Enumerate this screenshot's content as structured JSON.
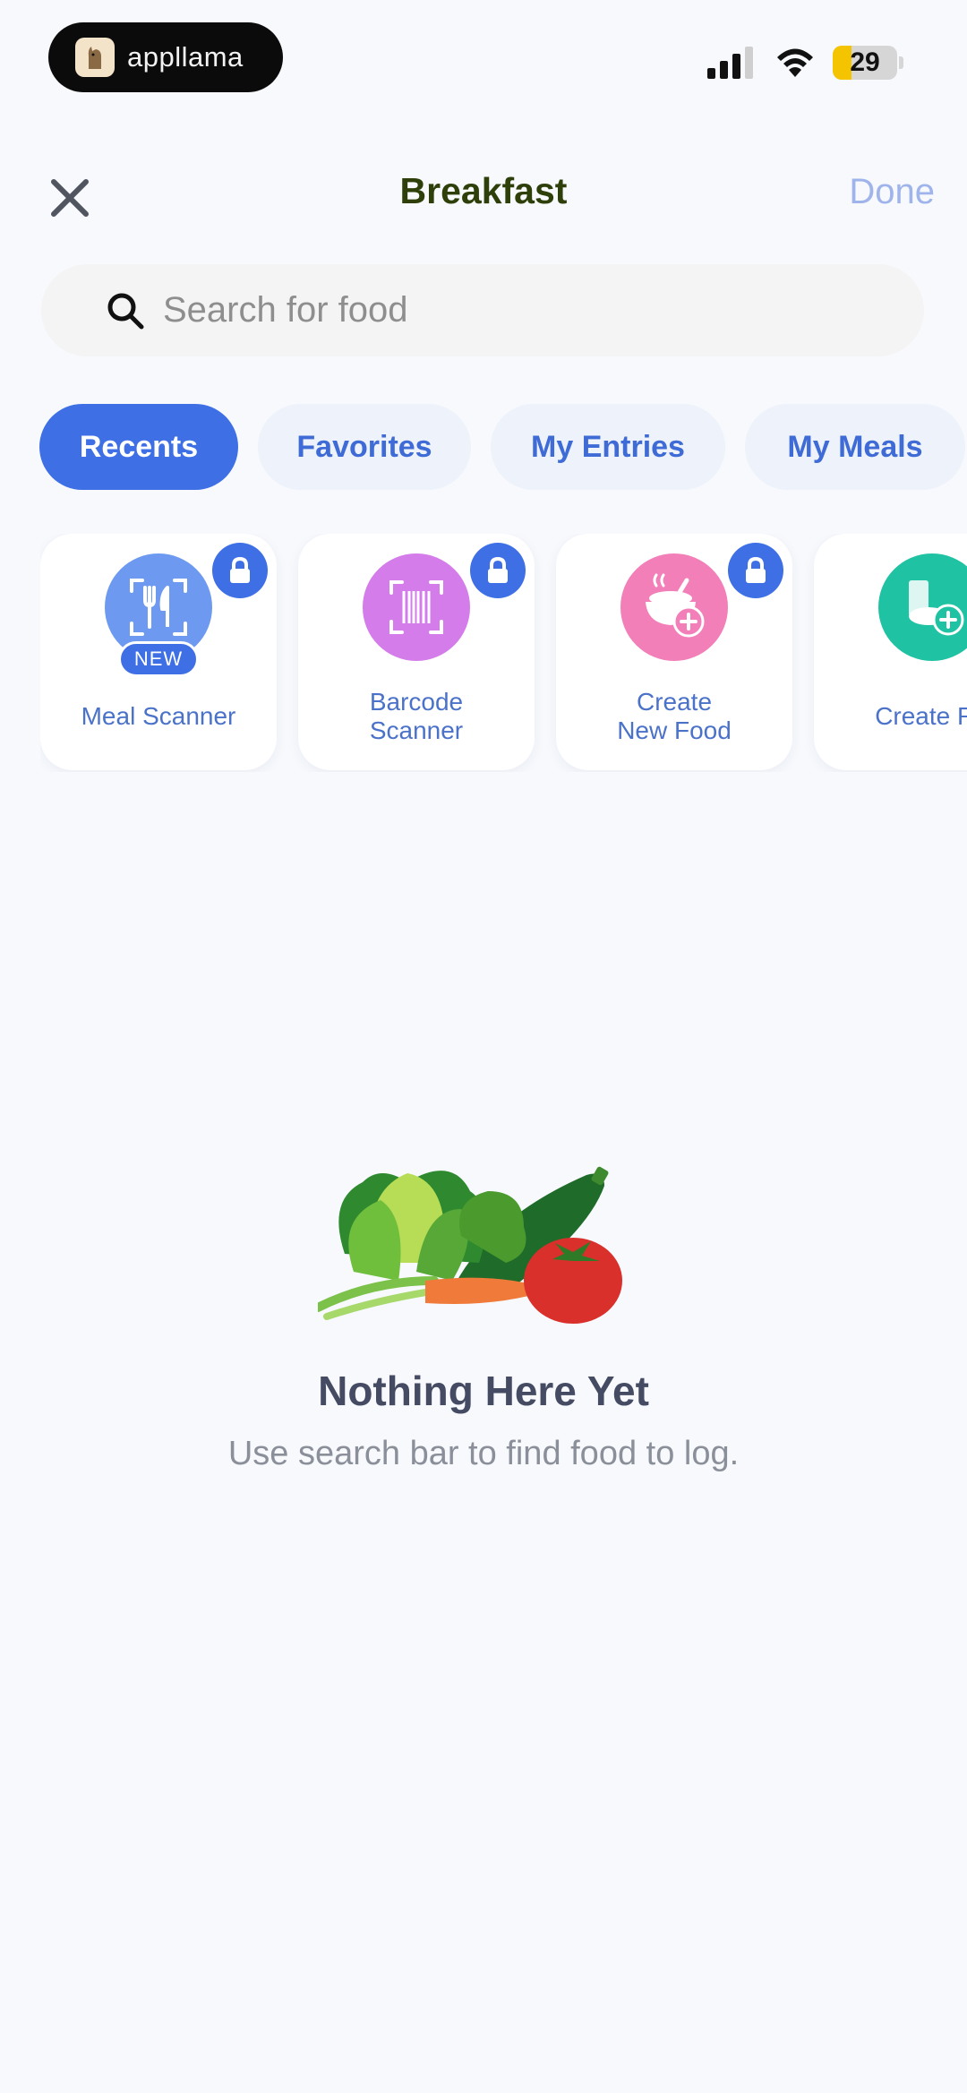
{
  "status_bar": {
    "app_name": "appllama",
    "battery": "29"
  },
  "header": {
    "title": "Breakfast",
    "done_label": "Done"
  },
  "search": {
    "placeholder": "Search for food",
    "value": ""
  },
  "tabs": [
    {
      "label": "Recents",
      "active": true
    },
    {
      "label": "Favorites",
      "active": false
    },
    {
      "label": "My Entries",
      "active": false
    },
    {
      "label": "My Meals",
      "active": false
    }
  ],
  "cards": [
    {
      "label": "Meal Scanner",
      "badge": "NEW",
      "icon": "fork-knife-scan-icon",
      "color": "#6d9af0",
      "locked": true
    },
    {
      "label_line1": "Barcode",
      "label_line2": "Scanner",
      "icon": "barcode-icon",
      "color": "#d47cea",
      "locked": true
    },
    {
      "label_line1": "Create",
      "label_line2": "New Food",
      "icon": "food-bowl-plus-icon",
      "color": "#f27fb8",
      "locked": true
    },
    {
      "label": "Create Re",
      "icon": "recipe-plus-icon",
      "color": "#1fc2a3",
      "locked": false
    }
  ],
  "empty_state": {
    "title": "Nothing Here Yet",
    "subtitle": "Use search bar to find food to log."
  }
}
